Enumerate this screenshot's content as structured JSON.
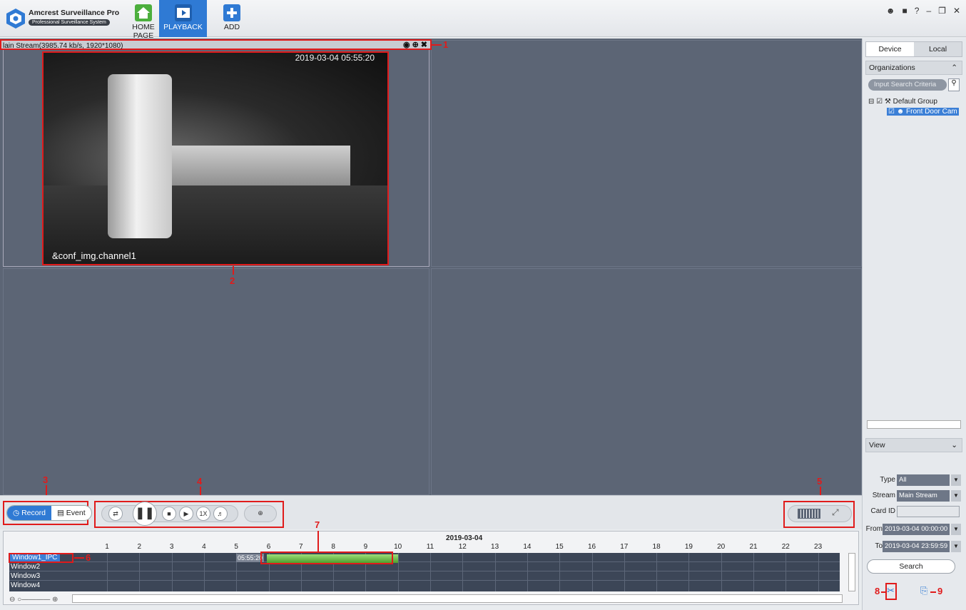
{
  "app": {
    "name": "Amcrest Surveillance Pro",
    "subtitle": "Professional Surveillance System"
  },
  "nav": {
    "home": "HOME PAGE",
    "playback": "PLAYBACK",
    "add": "ADD"
  },
  "window_controls": [
    "user-icon",
    "lock-icon",
    "help-icon",
    "minimize-icon",
    "restore-icon",
    "close-icon"
  ],
  "stream_bar": {
    "text": "lain Stream(3985.74 kb/s, 1920*1080)"
  },
  "video": {
    "timestamp": "2019-03-04 05:55:20",
    "channel_label": "&conf_img.channel1"
  },
  "callouts": [
    "1",
    "2",
    "3",
    "4",
    "5",
    "6",
    "7",
    "8",
    "9"
  ],
  "mode_toggle": {
    "record": "Record",
    "event": "Event",
    "selected": "Record"
  },
  "playback_controls": {
    "speed": "1X"
  },
  "timeline": {
    "date": "2019-03-04",
    "hours": [
      "1",
      "2",
      "3",
      "4",
      "5",
      "6",
      "7",
      "8",
      "9",
      "10",
      "11",
      "12",
      "13",
      "14",
      "15",
      "16",
      "17",
      "18",
      "19",
      "20",
      "21",
      "22",
      "23"
    ],
    "current_time": "05:55:20",
    "windows": [
      "Window1_IPC",
      "Window2",
      "Window3",
      "Window4"
    ]
  },
  "right_panel": {
    "tabs": [
      "Device",
      "Local"
    ],
    "organizations_header": "Organizations",
    "search_placeholder": "Input Search Criteria",
    "tree_group": "Default Group",
    "tree_device": "Front Door Cam",
    "view_header": "View",
    "type_label": "Type",
    "type_value": "All",
    "stream_label": "Stream",
    "stream_value": "Main Stream",
    "card_label": "Card ID",
    "from_label": "From",
    "from_value": "2019-03-04 00:00:00",
    "to_label": "To",
    "to_value": "2019-03-04 23:59:59",
    "search_button": "Search"
  },
  "colors": {
    "accent": "#2f7ad4",
    "callout": "#e01b1b",
    "record_green": "#5fb33a"
  }
}
